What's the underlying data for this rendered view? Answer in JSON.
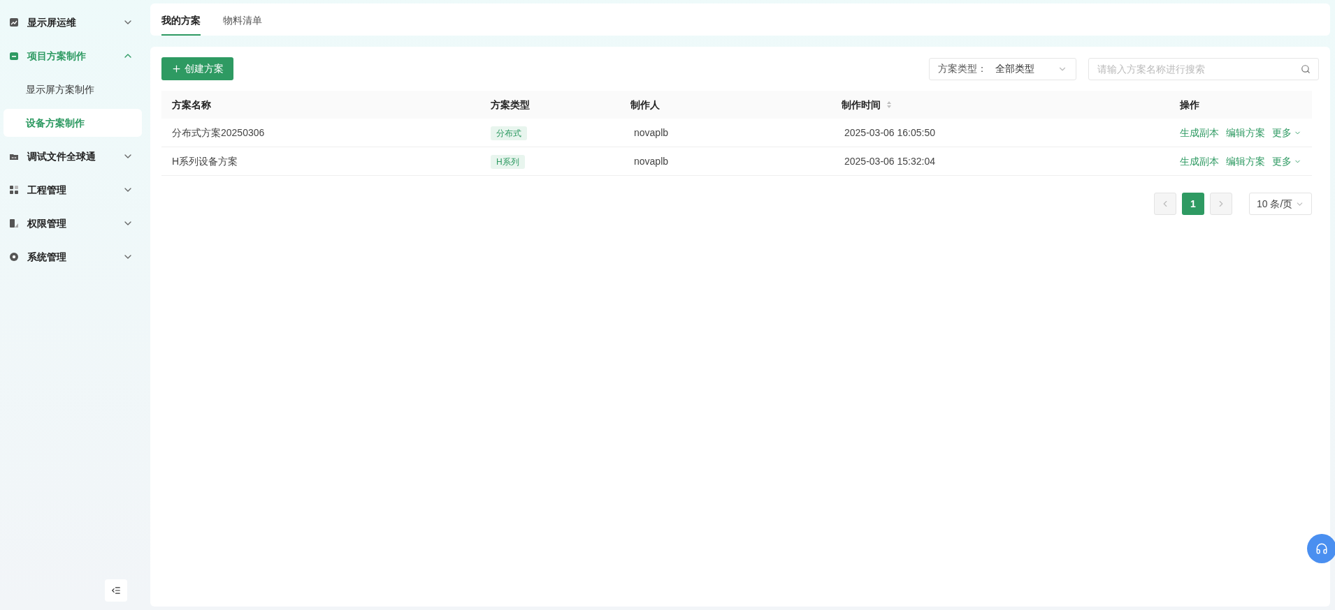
{
  "sidebar": {
    "items": [
      {
        "label": "显示屏运维",
        "expanded": false,
        "selected": false
      },
      {
        "label": "项目方案制作",
        "expanded": true,
        "selected": true,
        "children": [
          {
            "label": "显示屏方案制作",
            "selected": false
          },
          {
            "label": "设备方案制作",
            "selected": true
          }
        ]
      },
      {
        "label": "调试文件全球通",
        "expanded": false,
        "selected": false
      },
      {
        "label": "工程管理",
        "expanded": false,
        "selected": false
      },
      {
        "label": "权限管理",
        "expanded": false,
        "selected": false
      },
      {
        "label": "系统管理",
        "expanded": false,
        "selected": false
      }
    ]
  },
  "tabs": [
    {
      "label": "我的方案",
      "selected": true
    },
    {
      "label": "物料清单",
      "selected": false
    }
  ],
  "toolbar": {
    "create_button": "创建方案",
    "filter": {
      "label": "方案类型：",
      "value": "全部类型"
    },
    "search": {
      "placeholder": "请输入方案名称进行搜索"
    }
  },
  "table": {
    "columns": [
      {
        "label": "方案名称",
        "sortable": false
      },
      {
        "label": "方案类型",
        "sortable": false
      },
      {
        "label": "制作人",
        "sortable": false
      },
      {
        "label": "制作时间",
        "sortable": true
      },
      {
        "label": "操作",
        "sortable": false
      }
    ],
    "rows": [
      {
        "name": "分布式方案20250306",
        "type": "分布式",
        "creator": "novaplb",
        "time": "2025-03-06 16:05:50",
        "actions": [
          "生成副本",
          "编辑方案",
          "更多"
        ]
      },
      {
        "name": "H系列设备方案",
        "type": "H系列",
        "creator": "novaplb",
        "time": "2025-03-06 15:32:04",
        "actions": [
          "生成副本",
          "编辑方案",
          "更多"
        ]
      }
    ]
  },
  "pagination": {
    "pages": [
      {
        "label": "1",
        "selected": true
      }
    ],
    "page_size": "10 条/页"
  }
}
